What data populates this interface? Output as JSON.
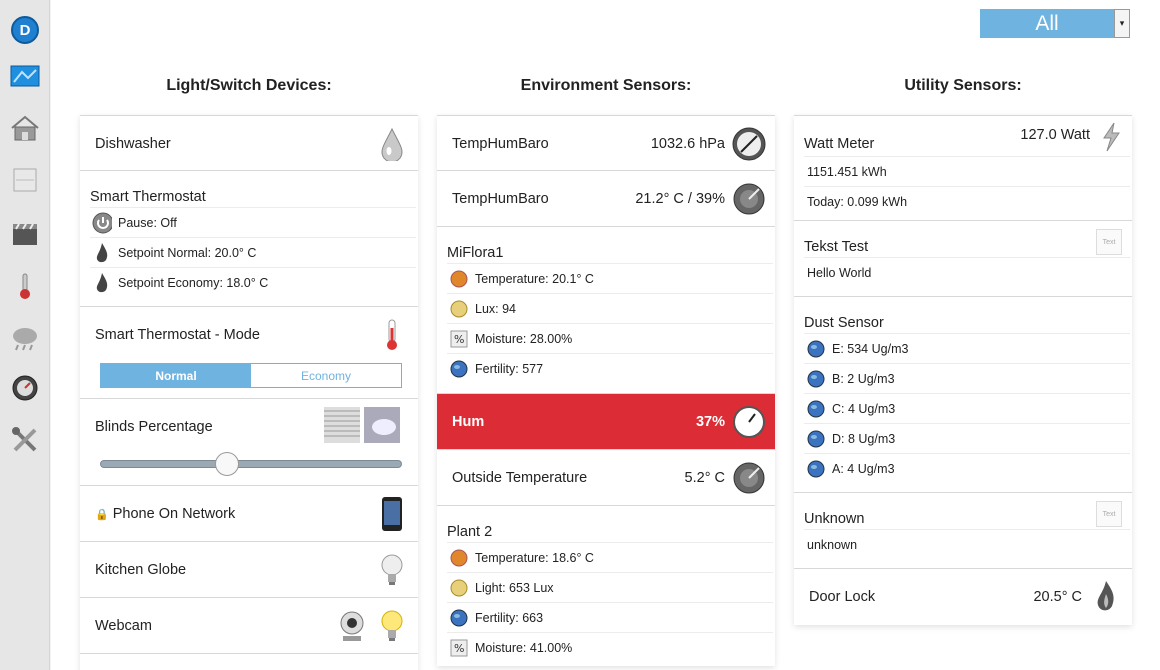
{
  "filter": {
    "selected": "All"
  },
  "sidebar": {
    "items": [
      {
        "name": "domoticz-logo"
      },
      {
        "name": "dashboard-icon"
      },
      {
        "name": "floorplans-icon"
      },
      {
        "name": "switches-icon"
      },
      {
        "name": "scenes-icon"
      },
      {
        "name": "temperature-icon"
      },
      {
        "name": "weather-icon"
      },
      {
        "name": "utility-icon"
      },
      {
        "name": "setup-icon"
      }
    ]
  },
  "columns": {
    "lights": {
      "title": "Light/Switch Devices:",
      "dishwasher": "Dishwasher",
      "thermostat": {
        "title": "Smart Thermostat",
        "rows": [
          "Pause: Off",
          "Setpoint Normal: 20.0° C",
          "Setpoint Economy: 18.0° C"
        ]
      },
      "thermostat_mode": {
        "title": "Smart Thermostat - Mode",
        "normal": "Normal",
        "economy": "Economy"
      },
      "blinds": {
        "title": "Blinds Percentage",
        "level": 0.42
      },
      "phone": "Phone On Network",
      "globe": "Kitchen Globe",
      "webcam": "Webcam"
    },
    "env": {
      "title": "Environment Sensors:",
      "baro": {
        "title": "TempHumBaro",
        "value": "1032.6 hPa"
      },
      "temphum": {
        "title": "TempHumBaro",
        "value": "21.2° C / 39%"
      },
      "miflora": {
        "title": "MiFlora1",
        "rows": [
          "Temperature: 20.1° C",
          "Lux: 94",
          "Moisture: 28.00%",
          "Fertility: 577"
        ]
      },
      "hum": {
        "title": "Hum",
        "value": "37%"
      },
      "outside": {
        "title": "Outside Temperature",
        "value": "5.2° C"
      },
      "plant2": {
        "title": "Plant 2",
        "rows": [
          "Temperature: 18.6° C",
          "Light: 653 Lux",
          "Fertility: 663",
          "Moisture: 41.00%"
        ]
      }
    },
    "utility": {
      "title": "Utility Sensors:",
      "watt": {
        "title": "Watt Meter",
        "value": "127.0 Watt",
        "rows": [
          "1151.451 kWh",
          "Today: 0.099 kWh"
        ]
      },
      "tekst": {
        "title": "Tekst Test",
        "row": "Hello World"
      },
      "dust": {
        "title": "Dust Sensor",
        "rows": [
          "E: 534 Ug/m3",
          "B: 2 Ug/m3",
          "C: 4 Ug/m3",
          "D: 8 Ug/m3",
          "A: 4 Ug/m3"
        ]
      },
      "unknown": {
        "title": "Unknown",
        "row": "unknown"
      },
      "door": {
        "title": "Door Lock",
        "value": "20.5° C"
      },
      "text_icon_label": "Text"
    }
  },
  "colors": {
    "accent": "#6fb3e0",
    "alert": "#dc2c35"
  }
}
